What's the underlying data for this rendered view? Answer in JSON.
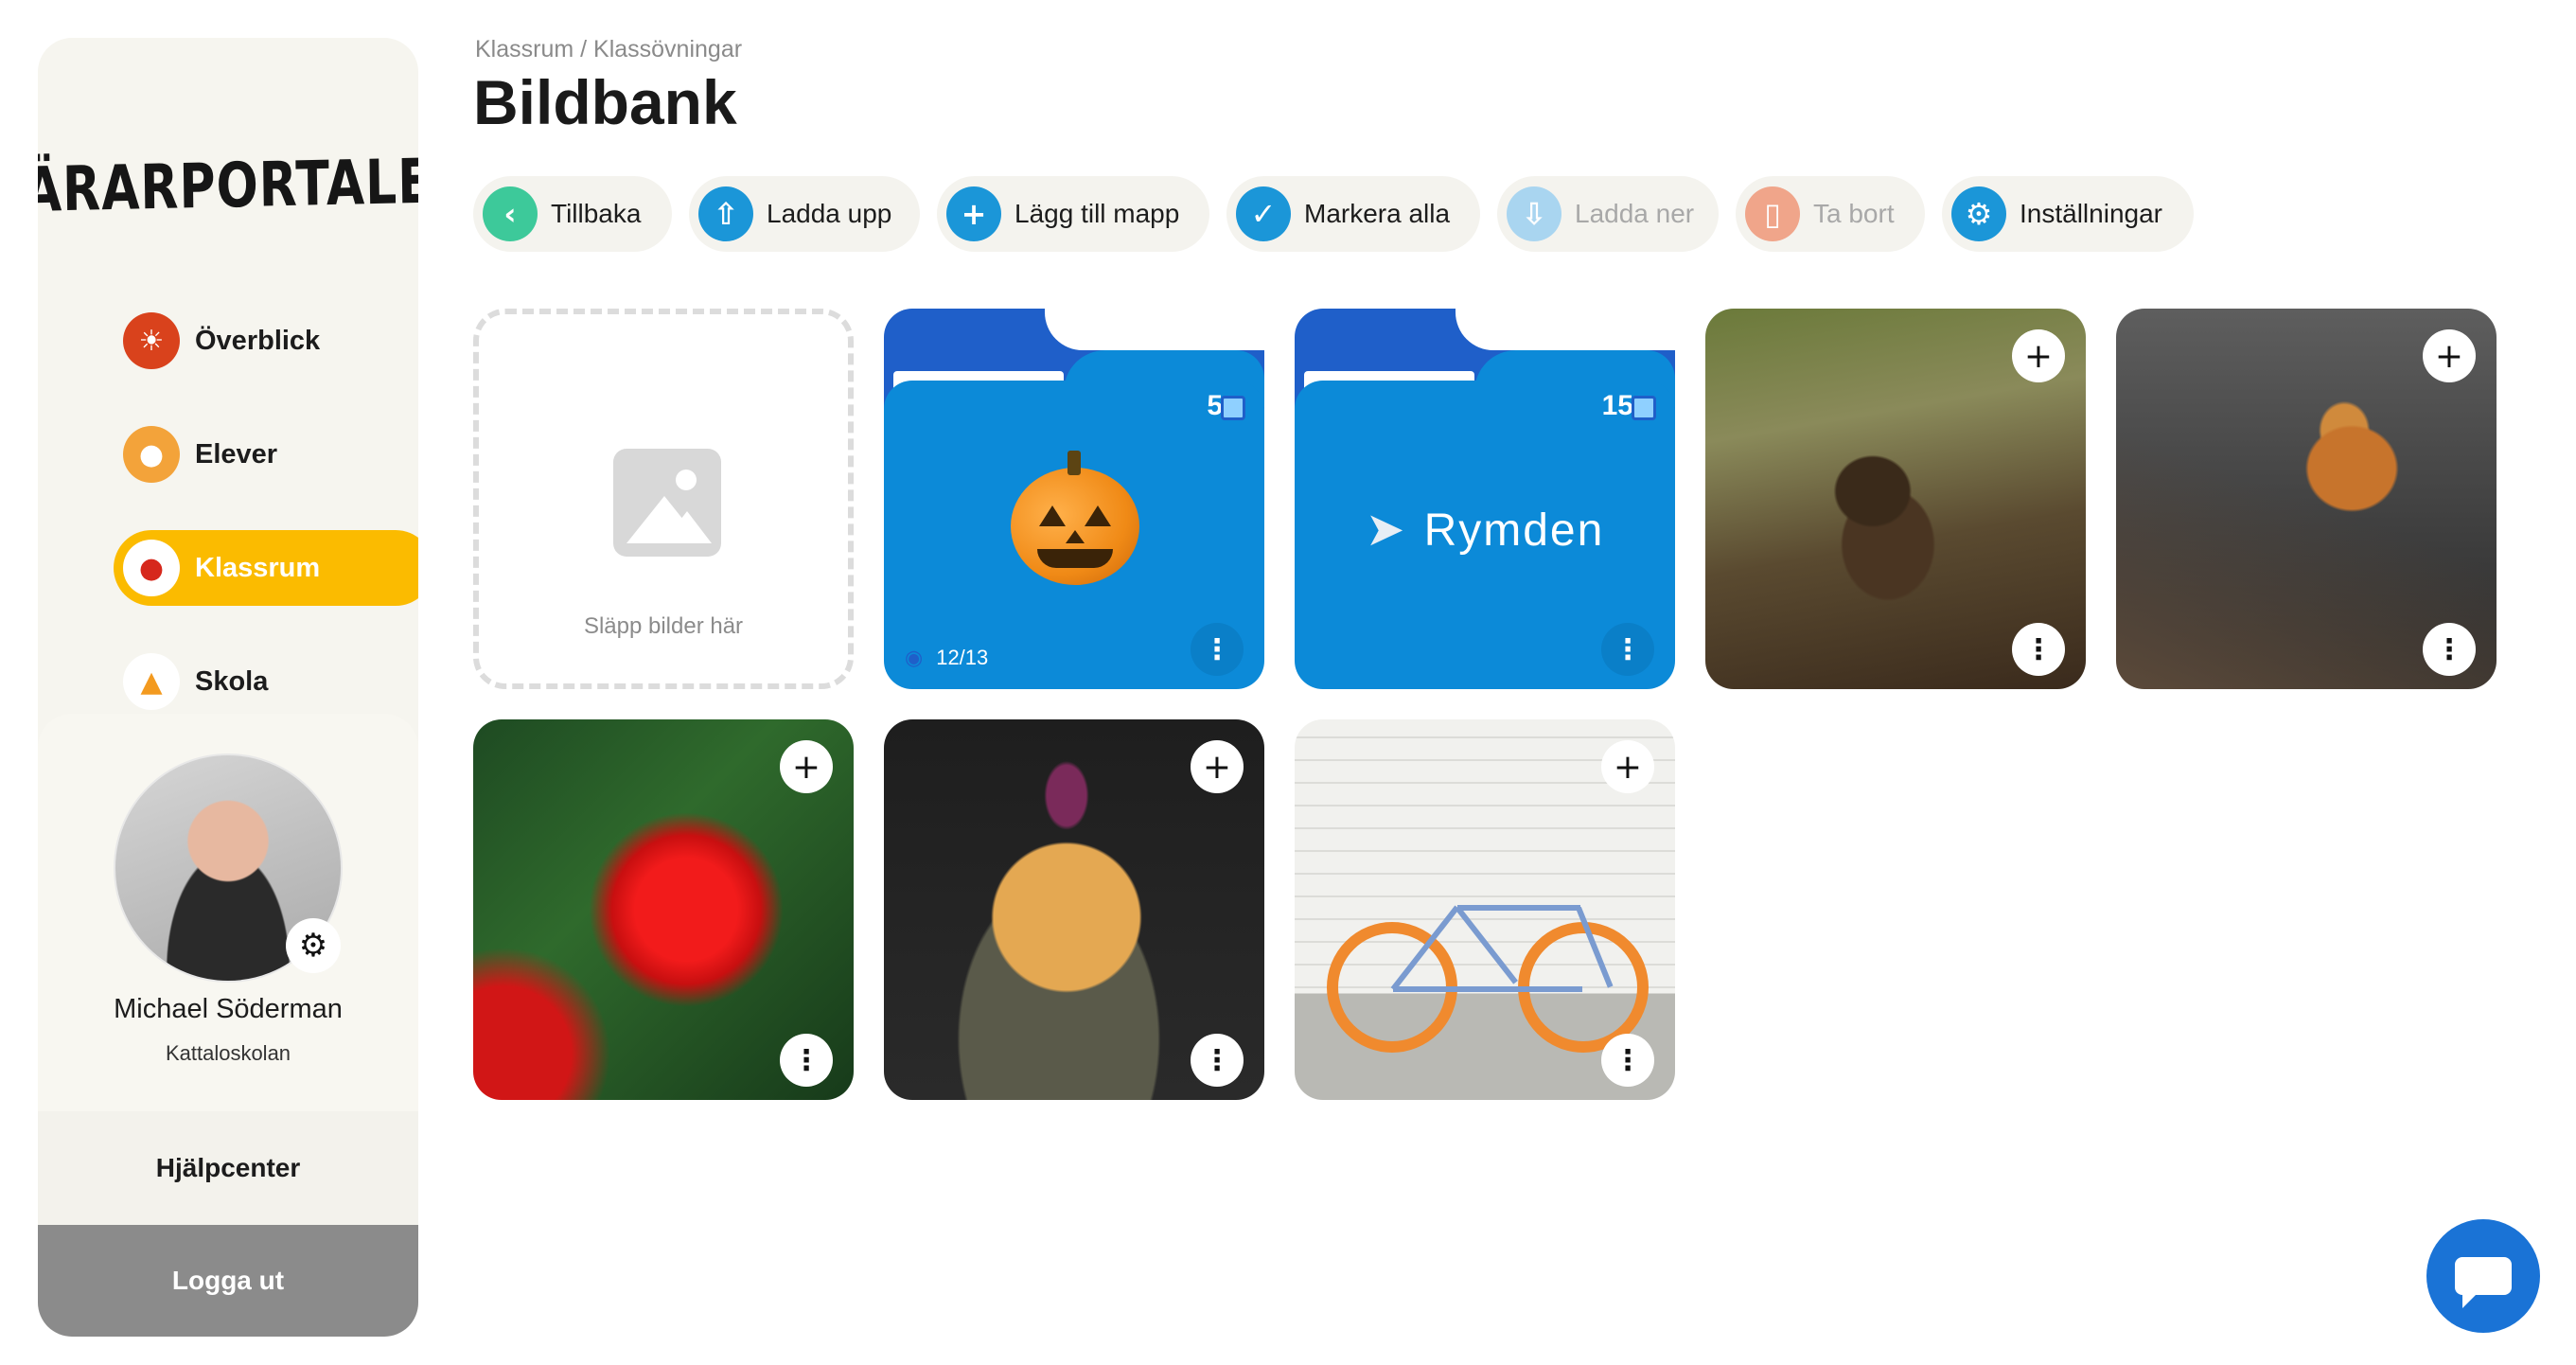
{
  "app": {
    "logo": "LÄRARPORTALEN"
  },
  "sidebar": {
    "items": [
      {
        "label": "Överblick",
        "icon": "lion-icon",
        "active": false
      },
      {
        "label": "Elever",
        "icon": "students-icon",
        "active": false
      },
      {
        "label": "Klassrum",
        "icon": "apple-icon",
        "active": true
      },
      {
        "label": "Skola",
        "icon": "school-icon",
        "active": false
      }
    ],
    "profile": {
      "name": "Michael Söderman",
      "school": "Kattaloskolan",
      "settings_icon": "gear-icon"
    },
    "help": "Hjälpcenter",
    "logout": "Logga ut"
  },
  "header": {
    "breadcrumb": "Klassrum / Klassövningar",
    "title": "Bildbank"
  },
  "toolbar": {
    "buttons": [
      {
        "label": "Tillbaka",
        "icon": "chevron-left-icon",
        "color": "#3dc99a",
        "enabled": true
      },
      {
        "label": "Ladda upp",
        "icon": "cloud-upload-icon",
        "color": "#1b96d8",
        "enabled": true
      },
      {
        "label": "Lägg till mapp",
        "icon": "plus-icon",
        "color": "#1b96d8",
        "enabled": true
      },
      {
        "label": "Markera alla",
        "icon": "check-icon",
        "color": "#1b96d8",
        "enabled": true
      },
      {
        "label": "Ladda ner",
        "icon": "cloud-download-icon",
        "color": "#a9d5f0",
        "enabled": false
      },
      {
        "label": "Ta bort",
        "icon": "trash-icon",
        "color": "#f0a58a",
        "enabled": false
      },
      {
        "label": "Inställningar",
        "icon": "settings-icon",
        "color": "#1b96d8",
        "enabled": true
      }
    ]
  },
  "grid": {
    "dropzone_label": "Släpp bilder här",
    "folders": [
      {
        "kind": "halloween",
        "count": "5",
        "visibility": "12/13"
      },
      {
        "kind": "space",
        "count": "15",
        "title": "Rymden"
      }
    ],
    "images": [
      {
        "subject": "bear-cub"
      },
      {
        "subject": "tiger"
      },
      {
        "subject": "red-rose"
      },
      {
        "subject": "pancakes"
      },
      {
        "subject": "bicycle"
      }
    ]
  },
  "colors": {
    "accent": "#fbbb00",
    "primary": "#1b96d8",
    "folder_front": "#0c8ad8",
    "folder_back": "#1f5fc9",
    "chat": "#1a73d6"
  }
}
